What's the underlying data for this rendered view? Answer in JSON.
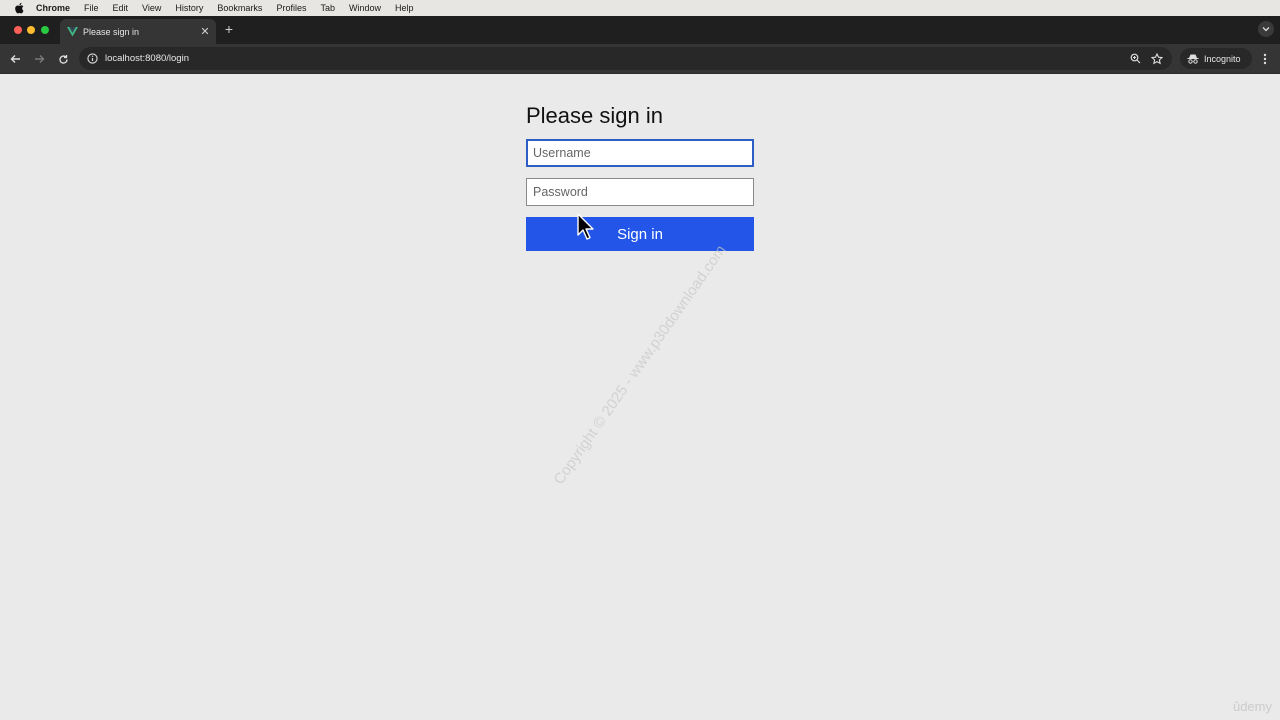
{
  "menubar": {
    "app": "Chrome",
    "items": [
      "File",
      "Edit",
      "View",
      "History",
      "Bookmarks",
      "Profiles",
      "Tab",
      "Window",
      "Help"
    ]
  },
  "tab": {
    "title": "Please sign in",
    "favicon": "vue-logo-icon"
  },
  "toolbar": {
    "url": "localhost:8080/login",
    "profile_label": "Incognito"
  },
  "login": {
    "heading": "Please sign in",
    "username_placeholder": "Username",
    "username_value": "",
    "password_placeholder": "Password",
    "password_value": "",
    "submit_label": "Sign in"
  },
  "watermark": "Copyright © 2025 - www.p30download.com",
  "brand_watermark": "ûdemy",
  "colors": {
    "button": "#2356e8",
    "focus_border": "#2c5ec4",
    "page_background": "#eaeaea"
  }
}
